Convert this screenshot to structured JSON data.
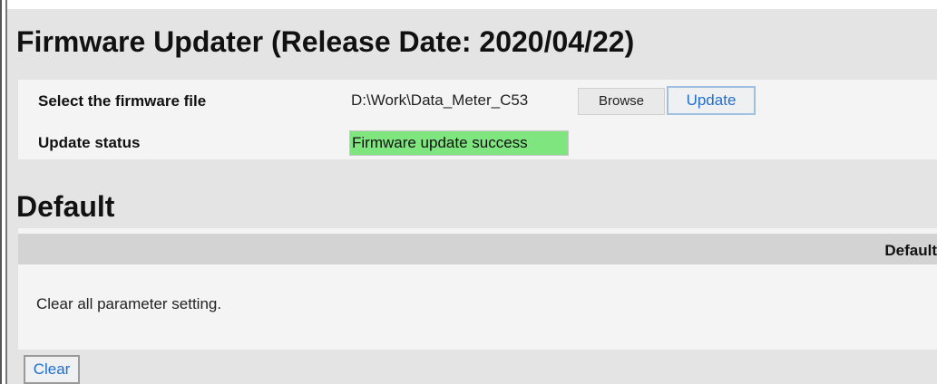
{
  "firmware": {
    "title": "Firmware Updater (Release Date: 2020/04/22)",
    "file_label": "Select the firmware file",
    "file_value": "D:\\Work\\Data_Meter_C53",
    "browse_label": "Browse",
    "update_label": "Update",
    "status_label": "Update status",
    "status_value": "Firmware update success",
    "status_color": "#7fe67f"
  },
  "default": {
    "title": "Default",
    "header_label": "Default",
    "description": "Clear all parameter setting.",
    "clear_label": "Clear"
  },
  "colors": {
    "button_text": "#1f6fcf",
    "background": "#e4e4e4"
  }
}
